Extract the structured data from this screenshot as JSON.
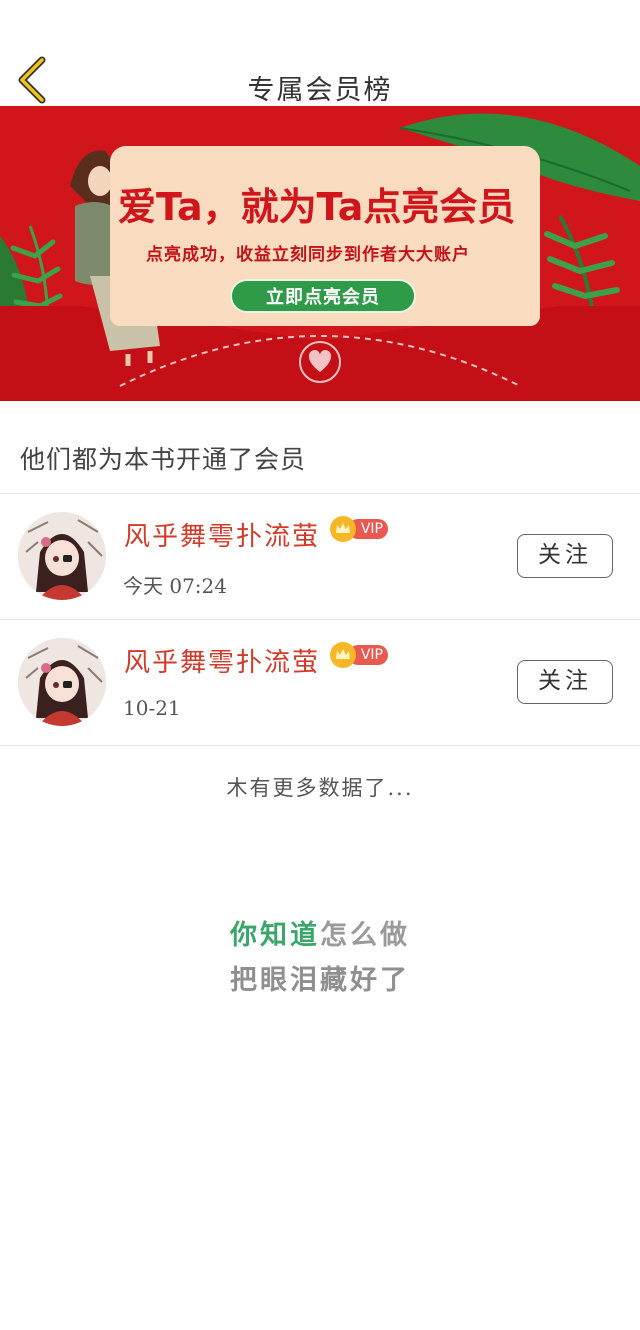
{
  "header": {
    "title": "专属会员榜",
    "back_icon": "chevron-left-icon"
  },
  "banner": {
    "headline": "爱Ta，就为Ta点亮会员",
    "subtitle": "点亮成功，收益立刻同步到作者大大账户",
    "cta": "立即点亮会员",
    "colors": {
      "background": "#d0151b",
      "card": "#f9dcc0",
      "cta": "#2f9a48"
    }
  },
  "section": {
    "title": "他们都为本书开通了会员"
  },
  "members": [
    {
      "name": "风乎舞雩扑流萤",
      "badge": "VIP",
      "time": "今天 07:24",
      "follow_label": "关注"
    },
    {
      "name": "风乎舞雩扑流萤",
      "badge": "VIP",
      "time": "10-21",
      "follow_label": "关注"
    }
  ],
  "footer": {
    "no_more": "木有更多数据了...",
    "lyric_line1_part1": "你知道",
    "lyric_line1_part2": "怎么做",
    "lyric_line2": "把眼泪藏好了"
  },
  "colors": {
    "name": "#d23a2a",
    "vip": "#e85a4f",
    "accent_yellow": "#f0c419"
  }
}
